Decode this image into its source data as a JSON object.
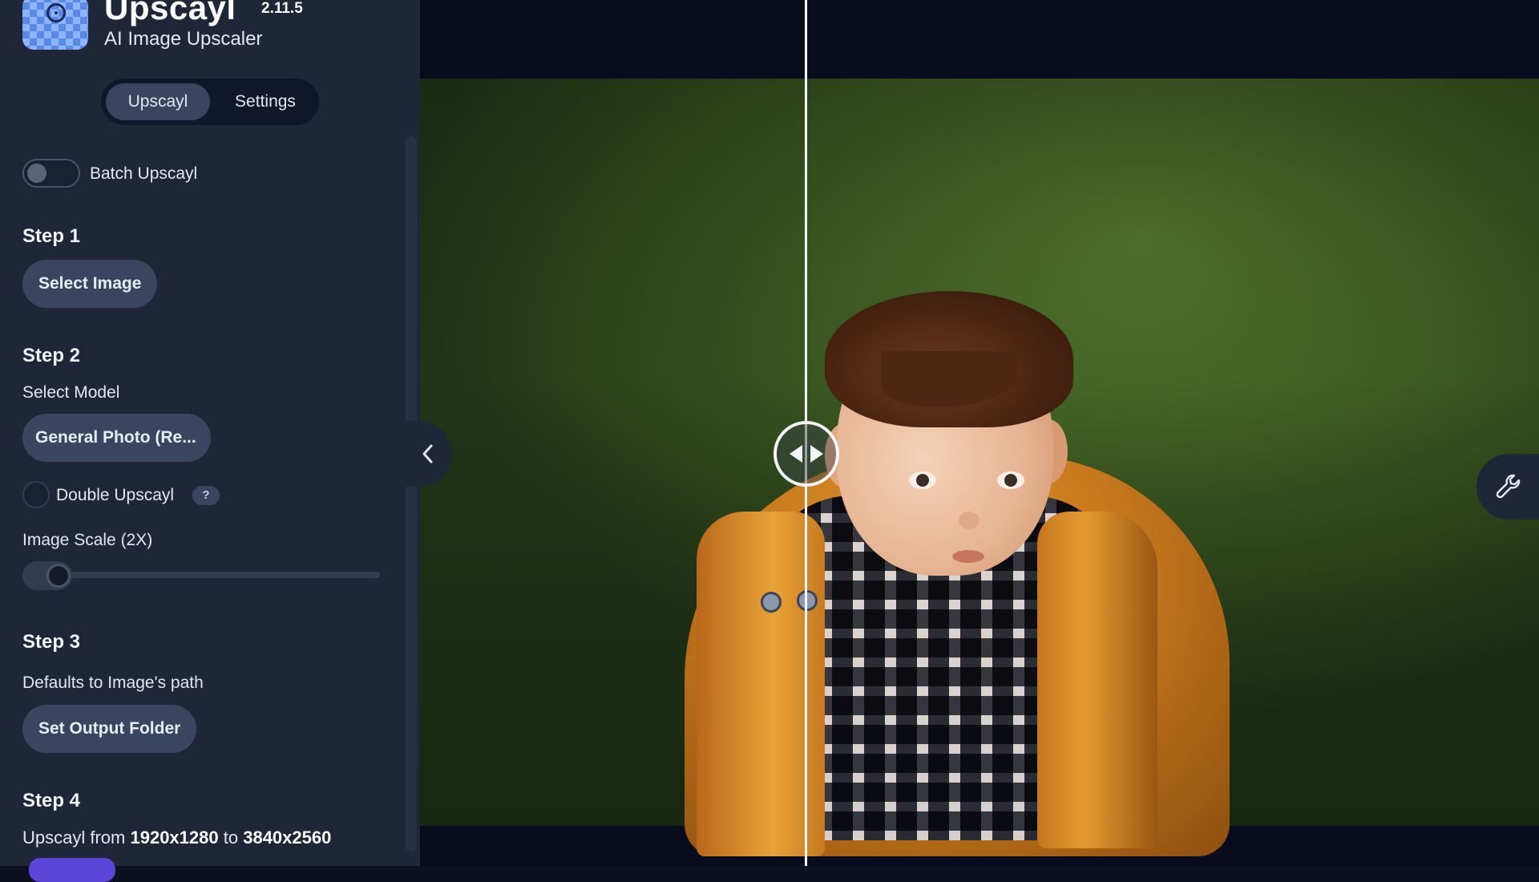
{
  "header": {
    "app_name": "Upscayl",
    "version": "2.11.5",
    "subtitle": "AI Image Upscaler"
  },
  "tabs": [
    {
      "label": "Upscayl",
      "active": true
    },
    {
      "label": "Settings",
      "active": false
    }
  ],
  "batch": {
    "label": "Batch Upscayl",
    "enabled": false
  },
  "step1": {
    "title": "Step 1",
    "button": "Select Image"
  },
  "step2": {
    "title": "Step 2",
    "model_label": "Select Model",
    "model_value": "General Photo (Re...",
    "double_label": "Double Upscayl",
    "double_help": "?",
    "scale_label": "Image Scale (2X)",
    "scale_value": 2
  },
  "step3": {
    "title": "Step 3",
    "hint": "Defaults to Image's path",
    "button": "Set Output Folder"
  },
  "step4": {
    "title": "Step 4",
    "prefix": "Upscayl from",
    "from": "1920x1280",
    "mid": "to",
    "to": "3840x2560"
  },
  "icons": {
    "compare": "compare-arrows-icon",
    "collapse": "chevron-left-icon",
    "tools": "wrench-icon"
  },
  "colors": {
    "sidebar": "#1e2637",
    "accent": "#5b45d9",
    "button": "#3a4660"
  }
}
